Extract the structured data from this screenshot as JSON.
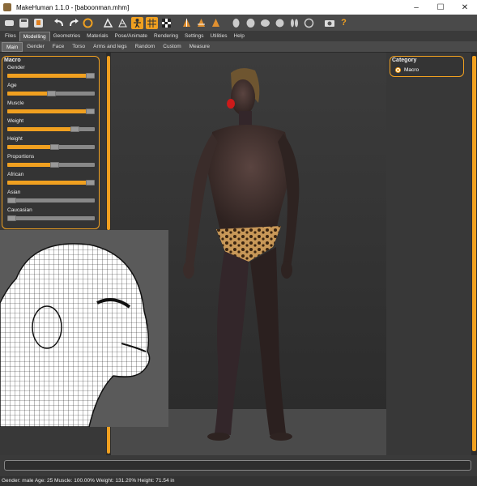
{
  "window": {
    "title": "MakeHuman 1.1.0 - [baboonman.mhm]",
    "controls": {
      "minimize": "–",
      "maximize": "☐",
      "close": "✕"
    }
  },
  "toolbar": {
    "icons": [
      "undo-all-icon",
      "save-icon",
      "export-icon",
      "undo-icon",
      "redo-icon",
      "reset-icon",
      "smooth-icon",
      "wireframe-icon",
      "pose-icon",
      "grid-icon",
      "checker-icon",
      "front-view-icon",
      "back-view-icon",
      "side-view-icon",
      "head-front-icon",
      "head-side-icon",
      "head-top-icon",
      "hand-icon",
      "feet-icon",
      "reset-camera-icon",
      "screenshot-icon",
      "help-icon"
    ],
    "selected": [
      "smooth-icon",
      "pose-icon",
      "grid-icon"
    ]
  },
  "menu": {
    "tabs": [
      "Files",
      "Modelling",
      "Geometries",
      "Materials",
      "Pose/Animate",
      "Rendering",
      "Settings",
      "Utilities",
      "Help"
    ],
    "active": "Modelling"
  },
  "subtabs": {
    "tabs": [
      "Main",
      "Gender",
      "Face",
      "Torso",
      "Arms and legs",
      "Random",
      "Custom",
      "Measure"
    ],
    "active": "Main"
  },
  "macro": {
    "title": "Macro",
    "sliders": [
      {
        "label": "Gender",
        "value": 1.0
      },
      {
        "label": "Age",
        "value": 0.5
      },
      {
        "label": "Muscle",
        "value": 1.0
      },
      {
        "label": "Weight",
        "value": 0.8
      },
      {
        "label": "Height",
        "value": 0.55
      },
      {
        "label": "Proportions",
        "value": 0.55
      },
      {
        "label": "African",
        "value": 1.0
      },
      {
        "label": "Asian",
        "value": 0.0
      },
      {
        "label": "Caucasian",
        "value": 0.0
      }
    ]
  },
  "category": {
    "title": "Category",
    "option": "Macro",
    "selected": true
  },
  "status": {
    "text": "Gender: male Age: 25 Muscle: 100.00% Weight: 131.20% Height: 71.54 in"
  },
  "colors": {
    "accent": "#f0a020",
    "panel": "#383838",
    "skin": "#3e2e2a",
    "nose": "#cc1a1a"
  }
}
